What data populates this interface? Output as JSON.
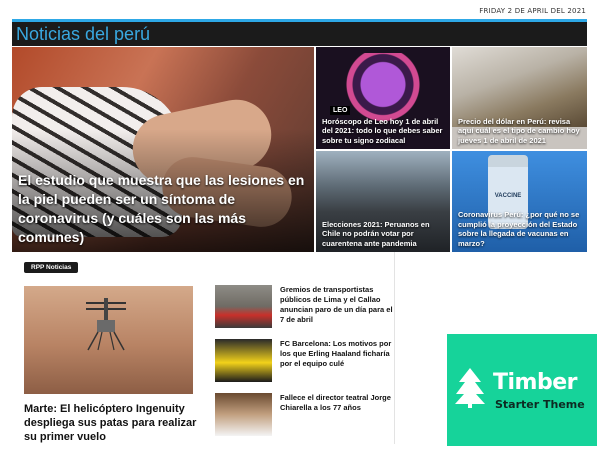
{
  "topbar": {
    "date": "FRIDAY 2 DE APRIL DEL 2021"
  },
  "header": {
    "brand": "Noticias del perú",
    "accent": "#39a8e0"
  },
  "hero": {
    "title": "El estudio que muestra que las lesiones en la piel pueden ser un síntoma de coronavirus (y cuáles son las más comunes)"
  },
  "tiles": [
    {
      "label": "LEO",
      "title": "Horóscopo de Leo hoy 1 de abril del 2021: todo lo que debes saber sobre tu signo zodiacal"
    },
    {
      "title": "Precio del dólar en Perú: revisa aquí cuál es el tipo de cambio hoy jueves 1 de abril de 2021"
    },
    {
      "title": "Elecciones 2021: Peruanos en Chile no podrán votar por cuarentena ante pandemia"
    },
    {
      "label": "VACCINE",
      "title": "Coronavirus Perú: ¿por qué no se cumplió la proyección del Estado sobre la llegada de vacunas en marzo?"
    }
  ],
  "section": {
    "tag": "RPP Noticias"
  },
  "featured": {
    "title": "Marte: El helicóptero Ingenuity despliega sus patas para realizar su primer vuelo"
  },
  "news": [
    {
      "title": "Gremios de transportistas públicos de Lima y el Callao anuncian paro de un día para el 7 de abril"
    },
    {
      "title": "FC Barcelona: Los motivos por los que Erling Haaland ficharía por el equipo culé"
    },
    {
      "title": "Fallece el director teatral Jorge Chiarella a los 77 años"
    }
  ],
  "sponsor": {
    "name": "Timber",
    "subtitle": "Starter Theme",
    "color": "#16d39a"
  }
}
